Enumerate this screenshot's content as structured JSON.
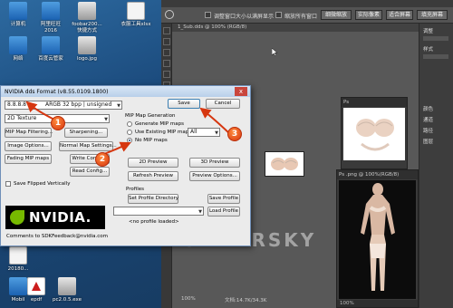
{
  "desktop": {
    "icons": [
      {
        "label": "计算机",
        "icon": "computer-icon"
      },
      {
        "label": "阿里旺旺 2016",
        "icon": "aliwangwang-icon"
      },
      {
        "label": "foobar200... 快捷方式",
        "icon": "foobar-icon"
      },
      {
        "label": "衣服工具xlsx",
        "icon": "spreadsheet-icon"
      },
      {
        "label": "网络",
        "icon": "network-icon"
      },
      {
        "label": "百度云管家",
        "icon": "baidu-cloud-icon"
      },
      {
        "label": "logo.jpg",
        "icon": "image-file-icon"
      },
      {
        "label": "20180...",
        "icon": "file-icon"
      },
      {
        "label": "Adobe Reader",
        "icon": "pdf-icon"
      },
      {
        "label": "Mobil",
        "icon": "file-icon"
      },
      {
        "label": "epdf",
        "icon": "pdf-icon"
      },
      {
        "label": "pc2.0.5.exe",
        "icon": "exe-icon"
      }
    ]
  },
  "photoshop": {
    "options": {
      "check1_label": "调整窗口大小以满屏显示",
      "check2_label": "缩放所有窗口",
      "btn1": "细微缩放",
      "btn2": "实际像素",
      "btn3": "适合屏幕",
      "btn4": "填充屏幕"
    },
    "doc_tab": "1_Sub.dds @ 100% (RGB/8)",
    "right_panel": [
      "调整",
      "样式",
      "颜色",
      "通道",
      "路径",
      "图层"
    ],
    "small_window_title": "Ps",
    "large_window_title": "Ps .png @ 100%(RGB/8)",
    "large_window_zoom": "100%",
    "status_zoom": "100%",
    "status_doc": "文档:14.7K/34.3K",
    "watermark": "GAMERSKY"
  },
  "dialog": {
    "title": "NVIDIA dds Format (v8.55.0109.1800)",
    "close": "x",
    "format_value": "8.8.8.8",
    "format_desc": "ARGB  32 bpp | unsigned",
    "save": "Save",
    "cancel": "Cancel",
    "texture_type": "2D Texture",
    "btn_mip_filtering": "MIP Map Filtering...",
    "btn_sharpening": "Sharpening...",
    "btn_image_options": "Image Options...",
    "btn_normal_map": "Normal Map Settings...",
    "btn_fading": "Fading MIP maps",
    "btn_write_config": "Write Config...",
    "btn_read_config": "Read Config...",
    "save_flipped": "Save Flipped Vertically",
    "mip_group": "MIP Map Generation",
    "mip_generate": "Generate MIP maps",
    "mip_use_existing": "Use Existing MIP maps",
    "mip_all": "All",
    "mip_none": "No MIP maps",
    "btn_2d_preview": "2D Preview",
    "btn_3d_preview": "3D Preview",
    "btn_refresh_preview": "Refresh Preview",
    "btn_preview_options": "Preview Options...",
    "profiles_label": "Profiles",
    "btn_set_profile_dir": "Set Profile Directory",
    "btn_save_profile": "Save Profile",
    "btn_load_profile": "Load Profile",
    "profile_status": "<no profile loaded>",
    "logo_text": "NVIDIA.",
    "comments": "Comments to SDKFeedback@nvidia.com"
  },
  "annotations": {
    "step1": "1",
    "step2": "2",
    "step3": "3",
    "color": "#d6360f"
  }
}
